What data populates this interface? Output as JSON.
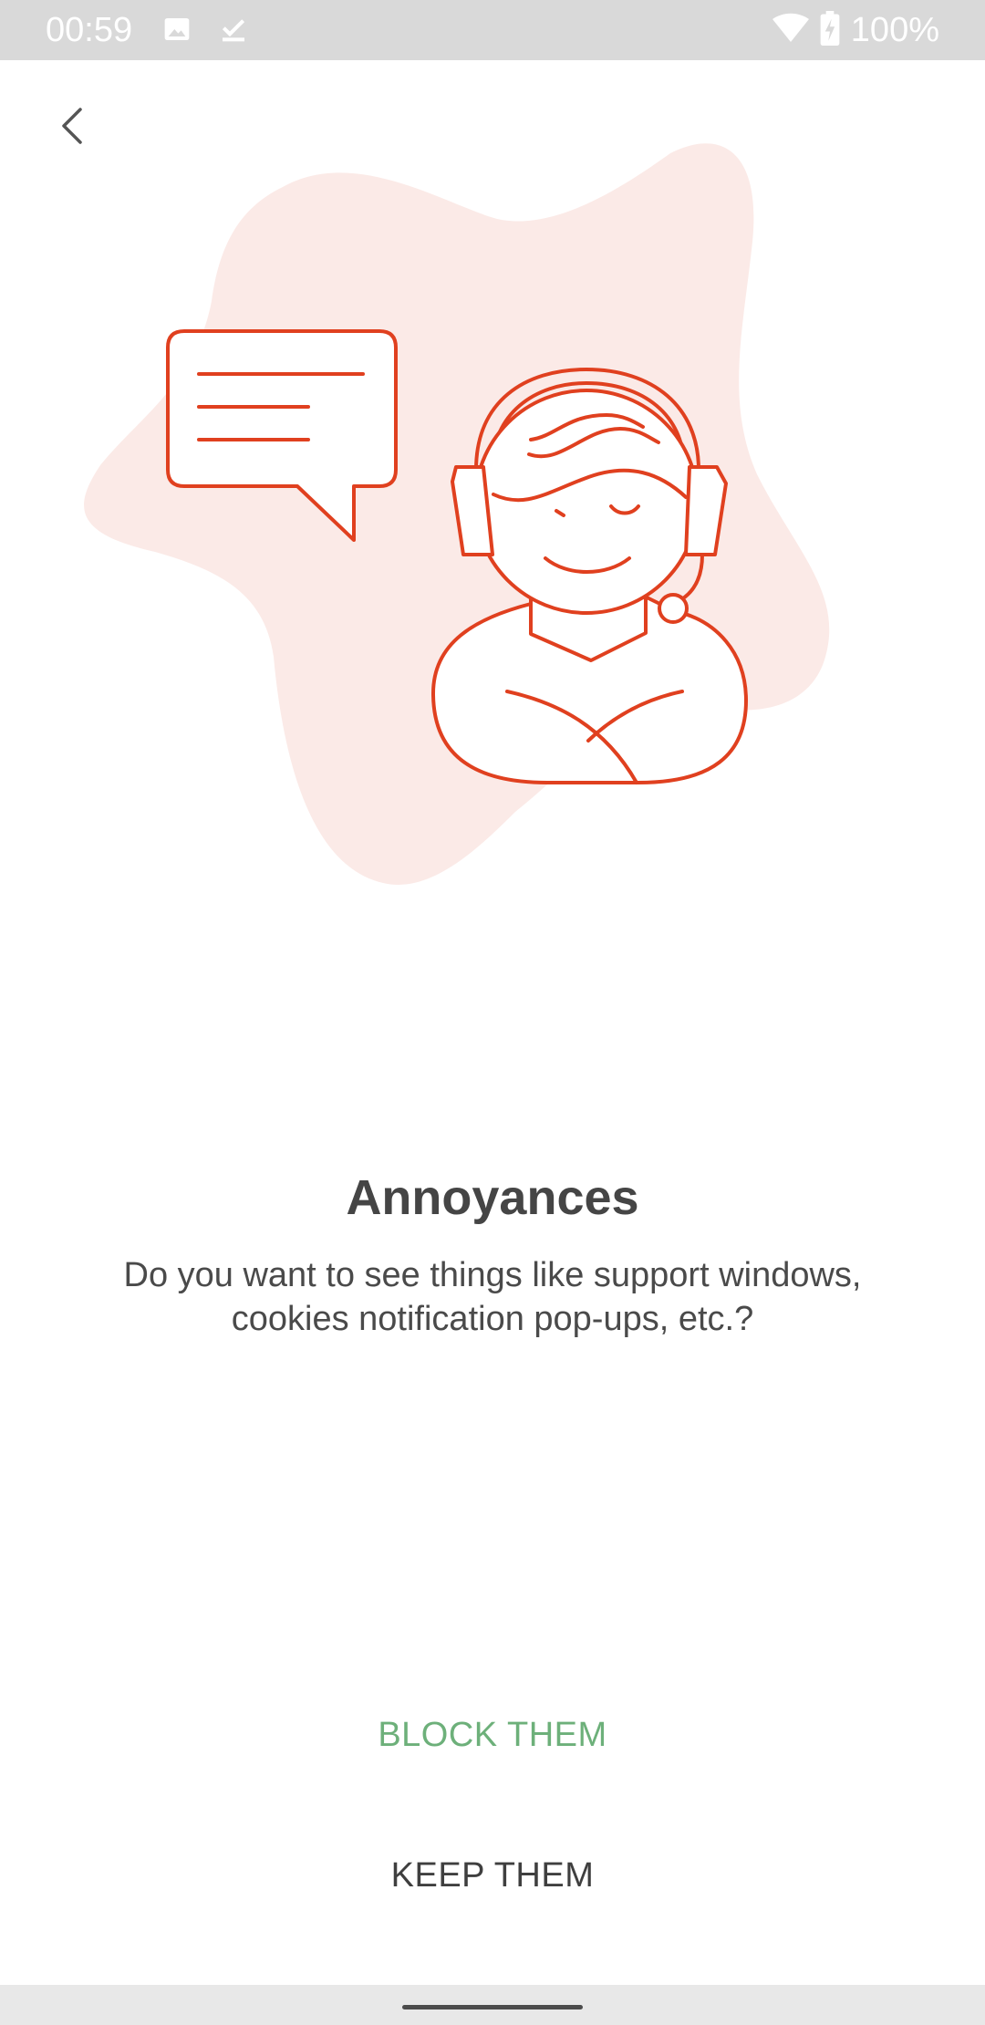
{
  "status_bar": {
    "time": "00:59",
    "battery": "100%",
    "icons_left": [
      "image-icon",
      "download-done-icon"
    ],
    "icons_right": [
      "wifi-icon",
      "battery-charging-icon"
    ]
  },
  "navigation": {
    "back_icon": "chevron-left-icon"
  },
  "illustration": {
    "subject": "person-with-headset-icon",
    "bubble": "chat-bubble-icon",
    "colors": {
      "line": "#E0401F",
      "blob": "#FBEAE7"
    }
  },
  "content": {
    "title": "Annoyances",
    "description": "Do you want to see things like support windows, cookies notification pop-ups, etc.?"
  },
  "actions": {
    "block_label": "BLOCK THEM",
    "keep_label": "KEEP THEM"
  },
  "colors": {
    "accent_green": "#6DB07A",
    "text_dark": "#454545",
    "status_bar_bg": "#D9D9D9"
  }
}
